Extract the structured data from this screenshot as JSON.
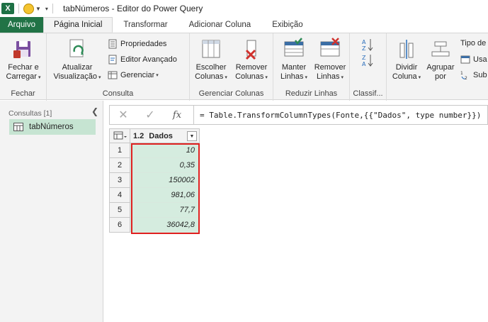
{
  "titlebar": {
    "app_icon": "excel-icon",
    "title": "tabNúmeros - Editor do Power Query"
  },
  "tabs": [
    {
      "label": "Arquivo"
    },
    {
      "label": "Página Inicial"
    },
    {
      "label": "Transformar"
    },
    {
      "label": "Adicionar Coluna"
    },
    {
      "label": "Exibição"
    }
  ],
  "ribbon": {
    "fechar": {
      "group_label": "Fechar",
      "close_load_label_1": "Fechar e",
      "close_load_label_2": "Carregar"
    },
    "consulta": {
      "group_label": "Consulta",
      "refresh_label_1": "Atualizar",
      "refresh_label_2": "Visualização",
      "properties_label": "Propriedades",
      "advanced_editor_label": "Editor Avançado",
      "manage_label": "Gerenciar"
    },
    "gerenciar_colunas": {
      "group_label": "Gerenciar Colunas",
      "choose_label_1": "Escolher",
      "choose_label_2": "Colunas",
      "remove_label_1": "Remover",
      "remove_label_2": "Colunas"
    },
    "reduzir_linhas": {
      "group_label": "Reduzir Linhas",
      "keep_label_1": "Manter",
      "keep_label_2": "Linhas",
      "remove_label_1": "Remover",
      "remove_label_2": "Linhas"
    },
    "classificar": {
      "group_label": "Classif..."
    },
    "transformar": {
      "split_label_1": "Dividir",
      "split_label_2": "Coluna",
      "group_label_1": "Agrupar",
      "group_label_2": "por",
      "datatype_label": "Tipo de",
      "use_label": "Usa",
      "replace_label": "Sub"
    }
  },
  "left_pane": {
    "header": "Consultas [1]",
    "queries": [
      {
        "label": "tabNúmeros"
      }
    ]
  },
  "formula_bar": {
    "cancel_glyph": "✕",
    "confirm_glyph": "✓",
    "fx_label": "fx",
    "formula": "= Table.TransformColumnTypes(Fonte,{{\"Dados\", type number}})"
  },
  "grid": {
    "column": {
      "type_label": "1.2",
      "name": "Dados"
    },
    "rows": [
      {
        "num": "1",
        "value": "10"
      },
      {
        "num": "2",
        "value": "0,35"
      },
      {
        "num": "3",
        "value": "150002"
      },
      {
        "num": "4",
        "value": "981,06"
      },
      {
        "num": "5",
        "value": "77,7"
      },
      {
        "num": "6",
        "value": "36042,8"
      }
    ]
  },
  "colors": {
    "excel_green": "#217346",
    "selected_query_bg": "#c6e4d2",
    "cell_bg": "#d5ecdf",
    "highlight_border": "#e02020"
  }
}
